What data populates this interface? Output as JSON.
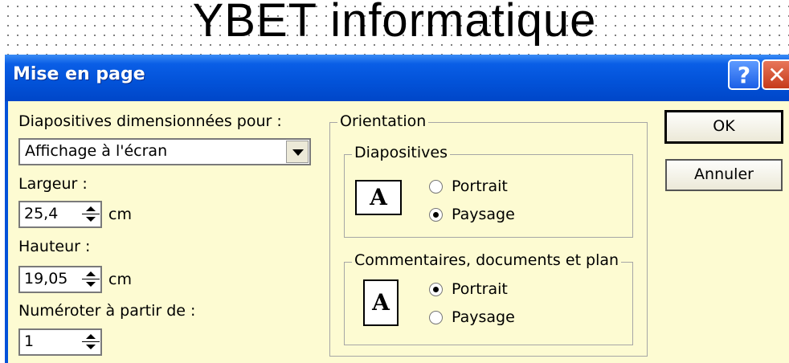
{
  "background": {
    "title": "YBET informatique"
  },
  "dialog": {
    "title": "Mise en page",
    "help_symbol": "?",
    "close_symbol": "✕",
    "size_for_label": "Diapositives dimensionnées pour :",
    "size_for_value": "Affichage à l'écran",
    "width_label": "Largeur :",
    "width_value": "25,4",
    "width_unit": "cm",
    "height_label": "Hauteur :",
    "height_value": "19,05",
    "height_unit": "cm",
    "number_label": "Numéroter à partir de :",
    "number_value": "1",
    "orientation": {
      "label": "Orientation",
      "slides": {
        "label": "Diapositives",
        "portrait": "Portrait",
        "landscape": "Paysage",
        "selected": "Paysage"
      },
      "notes": {
        "label": "Commentaires, documents et plan",
        "portrait": "Portrait",
        "landscape": "Paysage",
        "selected": "Portrait"
      },
      "icon_letter": "A"
    },
    "ok_label": "OK",
    "cancel_label": "Annuler"
  },
  "colors": {
    "titlebar": "#0252d8",
    "dialog_bg": "#fdfbd2"
  }
}
